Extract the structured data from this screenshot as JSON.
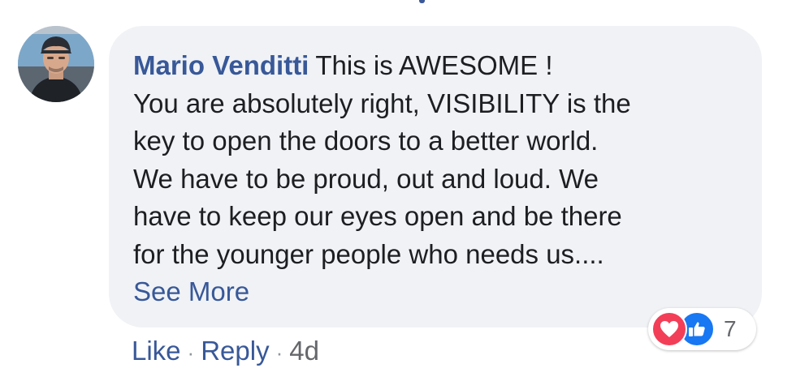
{
  "comment": {
    "author": "Mario Venditti",
    "lines": [
      "This is AWESOME !",
      "You are absolutely right, VISIBILITY is the",
      "key to open the doors to a better world.",
      "We have to be proud, out and loud. We",
      "have to keep our eyes open and be there",
      "for the younger people who needs us...."
    ],
    "see_more": "See More"
  },
  "reactions": {
    "icons": [
      "love-heart-icon",
      "thumbs-up-icon"
    ],
    "count": "7",
    "colors": {
      "love": "#f33e58",
      "like": "#1877f2"
    }
  },
  "actions": {
    "like": "Like",
    "separator": "·",
    "reply": "Reply",
    "timestamp": "4d"
  },
  "colors": {
    "bubble_bg": "#f0f2f5",
    "link": "#385898",
    "text": "#1c1e21",
    "meta": "#65676b"
  }
}
